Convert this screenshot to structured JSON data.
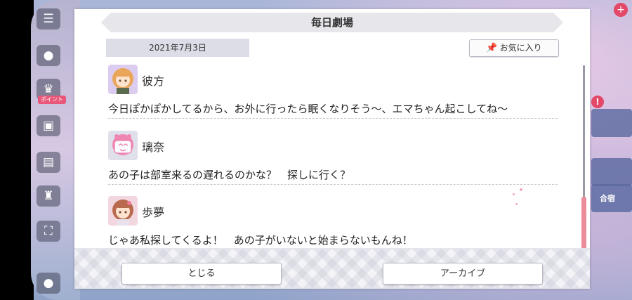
{
  "dialog": {
    "title": "毎日劇場",
    "date": "2021年7月3日",
    "favorite_label": "お気に入り",
    "close_label": "とじる",
    "archive_label": "アーカイブ"
  },
  "entries": [
    {
      "speaker": "彼方",
      "line": "今日ぽかぽかしてるから、お外に行ったら眠くなりそう～、エマちゃん起こしてね～",
      "avatar_color": "#f0b46e"
    },
    {
      "speaker": "璃奈",
      "line": "あの子は部室来るの遅れるのかな？　探しに行く？",
      "avatar_color": "#f08cb4"
    },
    {
      "speaker": "歩夢",
      "line": "じゃあ私探してくるよ！　あの子がいないと始まらないもんね！",
      "avatar_color": "#c87a5a"
    }
  ],
  "side_menu": {
    "badge_label": "ポイント"
  },
  "right_panel": {
    "tile_label": "合宿"
  },
  "colors": {
    "accent_pink": "#ec8c98",
    "title_bar": "#e6e6eb"
  }
}
